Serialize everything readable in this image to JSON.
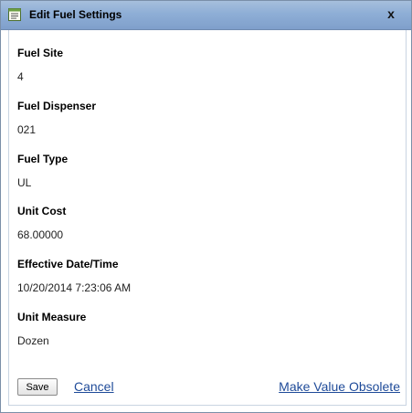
{
  "dialog": {
    "title": "Edit Fuel Settings",
    "close_label": "x",
    "title_icon": "notepad-icon"
  },
  "fields": [
    {
      "label": "Fuel Site",
      "value": "4"
    },
    {
      "label": "Fuel Dispenser",
      "value": "021"
    },
    {
      "label": "Fuel Type",
      "value": "UL"
    },
    {
      "label": "Unit Cost",
      "value": "68.00000"
    },
    {
      "label": "Effective Date/Time",
      "value": "10/20/2014 7:23:06 AM"
    },
    {
      "label": "Unit Measure",
      "value": "Dozen"
    }
  ],
  "actions": {
    "save_label": "Save",
    "cancel_label": "Cancel",
    "obsolete_label": "Make Value Obsolete"
  },
  "colors": {
    "titlebar": "#8eaed6",
    "link": "#1f4b99"
  }
}
